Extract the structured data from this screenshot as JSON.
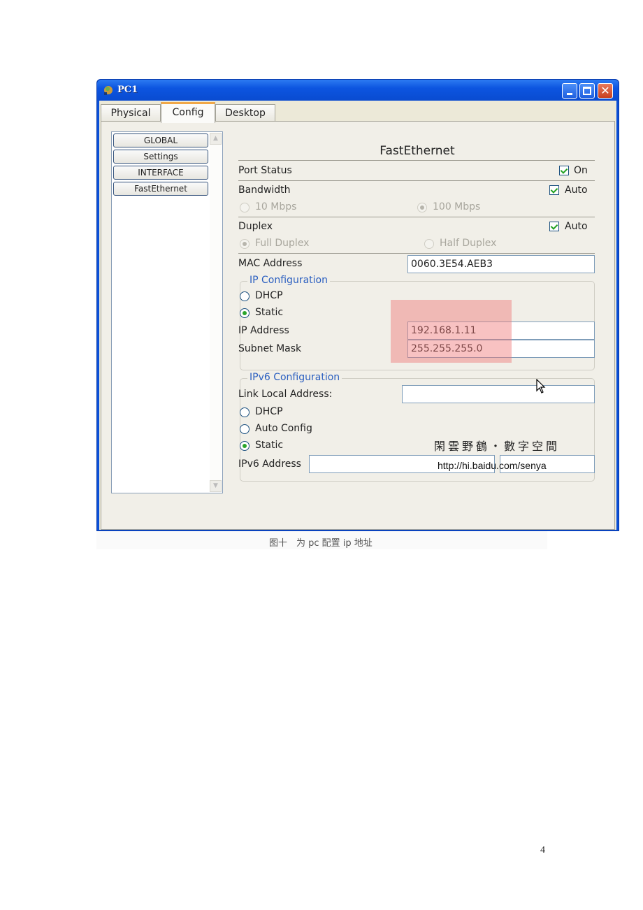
{
  "window": {
    "title": "PC1",
    "controls": {
      "minimize": "_",
      "maximize": "□",
      "close": "✕"
    }
  },
  "tabs": [
    {
      "label": "Physical",
      "active": false
    },
    {
      "label": "Config",
      "active": true
    },
    {
      "label": "Desktop",
      "active": false
    }
  ],
  "sidebar": {
    "items": [
      {
        "label": "GLOBAL"
      },
      {
        "label": "Settings"
      },
      {
        "label": "INTERFACE"
      },
      {
        "label": "FastEthernet"
      }
    ],
    "scroll_up": "▲",
    "scroll_down": "▼"
  },
  "interface": {
    "heading": "FastEthernet",
    "port_status": {
      "label": "Port Status",
      "checkbox_label": "On",
      "checked": true
    },
    "bandwidth": {
      "label": "Bandwidth",
      "checkbox_label": "Auto",
      "checked": true,
      "options": [
        {
          "label": "10 Mbps",
          "selected": false
        },
        {
          "label": "100 Mbps",
          "selected": true
        }
      ]
    },
    "duplex": {
      "label": "Duplex",
      "checkbox_label": "Auto",
      "checked": true,
      "options": [
        {
          "label": "Full Duplex",
          "selected": true
        },
        {
          "label": "Half Duplex",
          "selected": false
        }
      ]
    },
    "mac": {
      "label": "MAC Address",
      "value": "0060.3E54.AEB3"
    },
    "ip_config": {
      "legend": "IP Configuration",
      "dhcp_label": "DHCP",
      "static_label": "Static",
      "mode": "Static",
      "ip_label": "IP Address",
      "ip_value": "192.168.1.11",
      "mask_label": "Subnet Mask",
      "mask_value": "255.255.255.0"
    },
    "ipv6_config": {
      "legend": "IPv6 Configuration",
      "link_local_label": "Link Local Address:",
      "link_local_value": "",
      "dhcp_label": "DHCP",
      "auto_label": "Auto Config",
      "static_label": "Static",
      "mode": "Static",
      "address_label": "IPv6 Address",
      "address_value": "",
      "prefix_value": ""
    }
  },
  "watermark": {
    "chinese": "閑雲野鶴・數字空間",
    "url": "http://hi.baidu.com/senya"
  },
  "caption": "图十　为 pc 配置 ip 地址",
  "page_number": "4",
  "colors": {
    "titlebar": "#0c55e0",
    "legend_text": "#2b5fc0",
    "highlight": "#f07878",
    "tab_accent": "#f0a848"
  }
}
